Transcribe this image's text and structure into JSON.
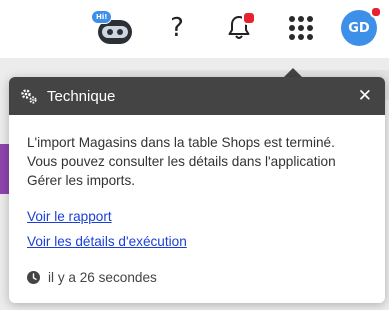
{
  "topbar": {
    "assistant_badge": "Hi!",
    "help_symbol": "?",
    "avatar_initials": "GD",
    "notification_dot_color": "#e8212f",
    "avatar_color": "#3d8fe8"
  },
  "notification": {
    "category": "Technique",
    "close_symbol": "✕",
    "message": "L'import Magasins dans la table Shops est terminé. Vous pouvez consulter les détails dans l'application Gérer les imports.",
    "links": [
      {
        "label": "Voir le rapport"
      },
      {
        "label": "Voir les détails d'exécution"
      }
    ],
    "timestamp": "il y a 26 secondes",
    "header_color": "#444444",
    "link_color": "#1a3fd8"
  }
}
